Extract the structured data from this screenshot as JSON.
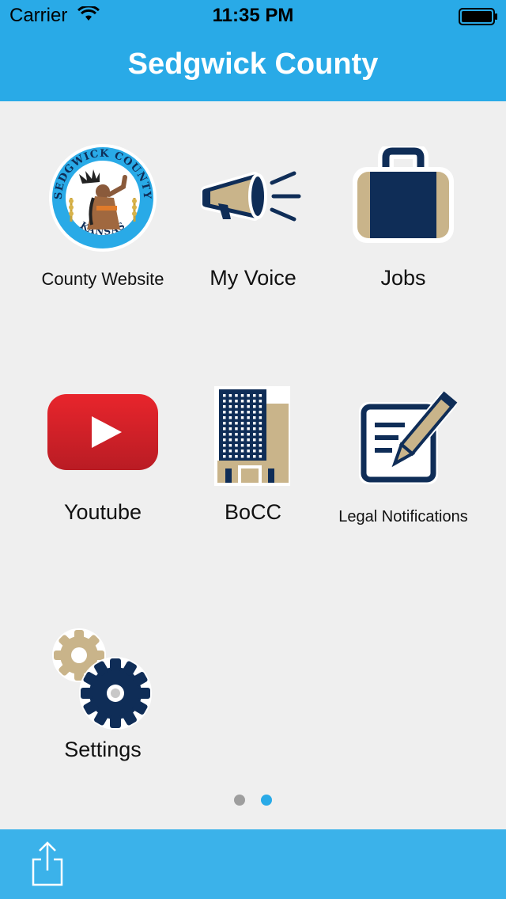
{
  "status": {
    "carrier": "Carrier",
    "time": "11:35 PM"
  },
  "nav": {
    "title": "Sedgwick County"
  },
  "tiles": {
    "county_website": "County Website",
    "my_voice": "My Voice",
    "jobs": "Jobs",
    "youtube": "Youtube",
    "bocc": "BoCC",
    "legal_notifications": "Legal Notifications",
    "settings": "Settings"
  },
  "seal": {
    "top_text": "SEDGWICK COUNTY",
    "bottom_text": "KANSAS"
  },
  "pager": {
    "current_page": 2,
    "total_pages": 2
  },
  "colors": {
    "header_blue": "#29aae7",
    "toolbar_blue": "#3bb2ea",
    "navy": "#0f2d57",
    "tan": "#c9b48a",
    "youtube_red": "#d9242b",
    "dot_active": "#29aae7",
    "dot_inactive": "#9e9e9e"
  },
  "icons": {
    "county_website": "county-seal-icon",
    "my_voice": "megaphone-icon",
    "jobs": "briefcase-icon",
    "youtube": "youtube-icon",
    "bocc": "office-building-icon",
    "legal_notifications": "document-pen-icon",
    "settings": "gears-icon",
    "share": "share-icon"
  }
}
